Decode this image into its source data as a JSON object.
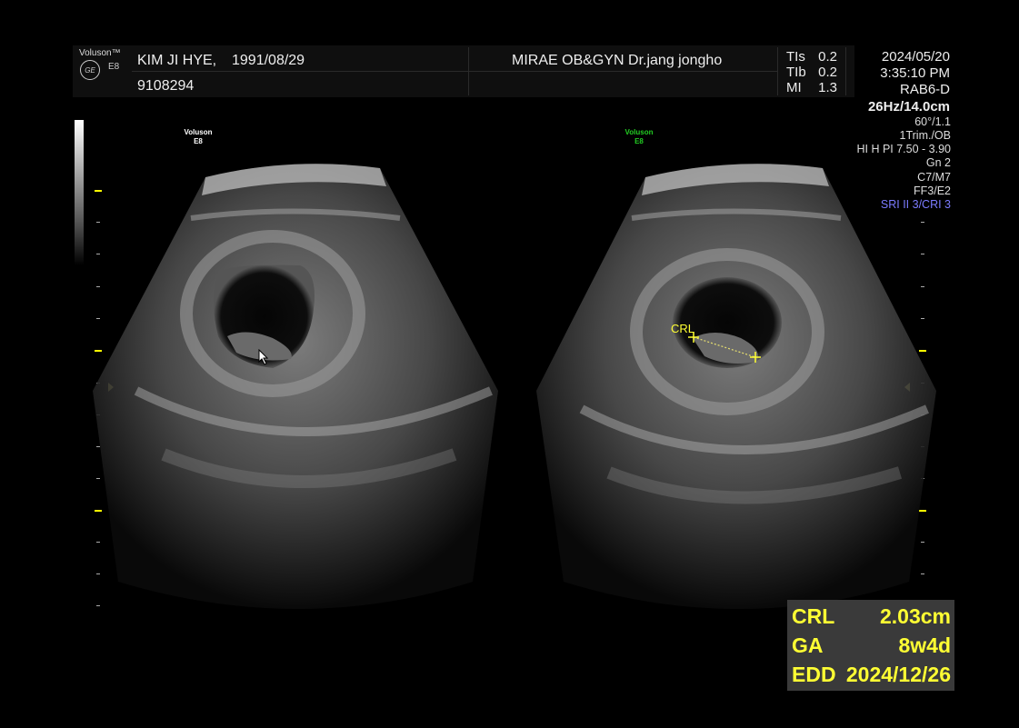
{
  "device": {
    "brand": "Voluson™",
    "model": "E8",
    "logo_text": "GE"
  },
  "patient": {
    "name": "KIM JI HYE,",
    "dob": "1991/08/29",
    "id": "9108294"
  },
  "institution": "MIRAE OB&GYN Dr.jang jongho",
  "safety_indices": [
    {
      "label": "TIs",
      "value": "0.2"
    },
    {
      "label": "TIb",
      "value": "0.2"
    },
    {
      "label": "MI",
      "value": "1.3"
    }
  ],
  "datetime": {
    "date": "2024/05/20",
    "time": "3:35:10 PM"
  },
  "probe": "RAB6-D",
  "settings": {
    "frame_depth": "26Hz/14.0cm",
    "angle": "60°/1.1",
    "preset": "1Trim./OB",
    "harmonic": "HI H PI 7.50 - 3.90",
    "gain": "Gn  2",
    "map": "C7/M7",
    "filter": "FF3/E2",
    "sri": "SRI II 3/CRI 3"
  },
  "scan_labels": {
    "left": {
      "line1": "Voluson",
      "line2": "E8"
    },
    "right": {
      "line1": "Voluson",
      "line2": "E8"
    }
  },
  "caliper_label": "CRL",
  "measurements": [
    {
      "label": "CRL",
      "value": "2.03cm"
    },
    {
      "label": "GA",
      "value": "8w4d"
    },
    {
      "label": "EDD",
      "value": "2024/12/26"
    }
  ],
  "colors": {
    "measure": "#ffff33",
    "sri": "#7b7bff",
    "right_label": "#22cc22"
  }
}
